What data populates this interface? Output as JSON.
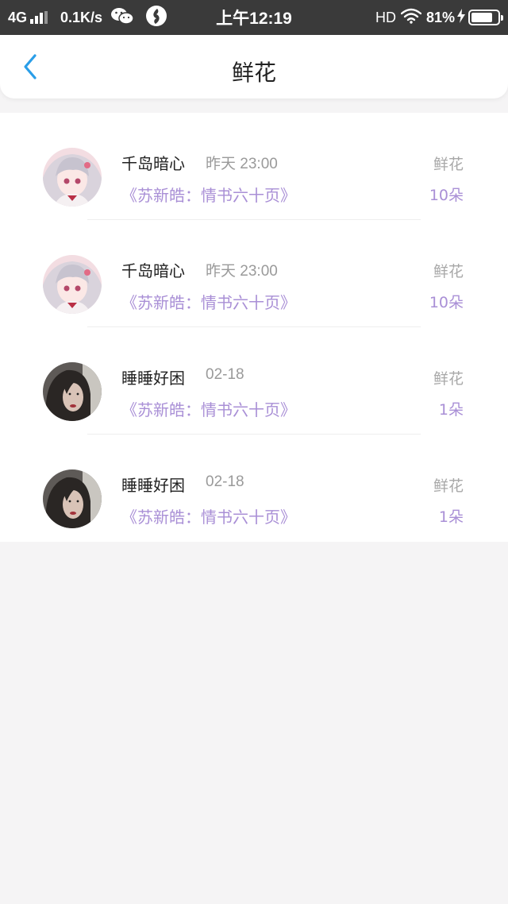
{
  "status_bar": {
    "network": "4G",
    "speed": "0.1K/s",
    "time": "上午12:19",
    "hd": "HD",
    "battery": "81%",
    "battery_level": 0.81,
    "icons": [
      "signal-icon",
      "wechat-icon",
      "app-notification-icon",
      "wifi-icon",
      "charging-icon",
      "battery-icon"
    ]
  },
  "header": {
    "title": "鲜花",
    "back_icon": "chevron-left-icon",
    "accent_color": "#2a9ee8"
  },
  "gift_list": [
    {
      "name": "千岛暗心",
      "time": "昨天 23:00",
      "book": "《苏新皓：情书六十页》",
      "gift": "鲜花",
      "count": "10朵",
      "avatar": "anime-avatar"
    },
    {
      "name": "千岛暗心",
      "time": "昨天 23:00",
      "book": "《苏新皓：情书六十页》",
      "gift": "鲜花",
      "count": "10朵",
      "avatar": "anime-avatar"
    },
    {
      "name": "睡睡好困",
      "time": "02-18",
      "book": "《苏新皓：情书六十页》",
      "gift": "鲜花",
      "count": "1朵",
      "avatar": "photo-avatar"
    },
    {
      "name": "睡睡好困",
      "time": "02-18",
      "book": "《苏新皓：情书六十页》",
      "gift": "鲜花",
      "count": "1朵",
      "avatar": "photo-avatar"
    }
  ],
  "colors": {
    "book_link": "#a98fd6",
    "muted_text": "#9a9a9a",
    "status_bar_bg": "#3a3a3a",
    "page_bg": "#f5f4f5"
  }
}
